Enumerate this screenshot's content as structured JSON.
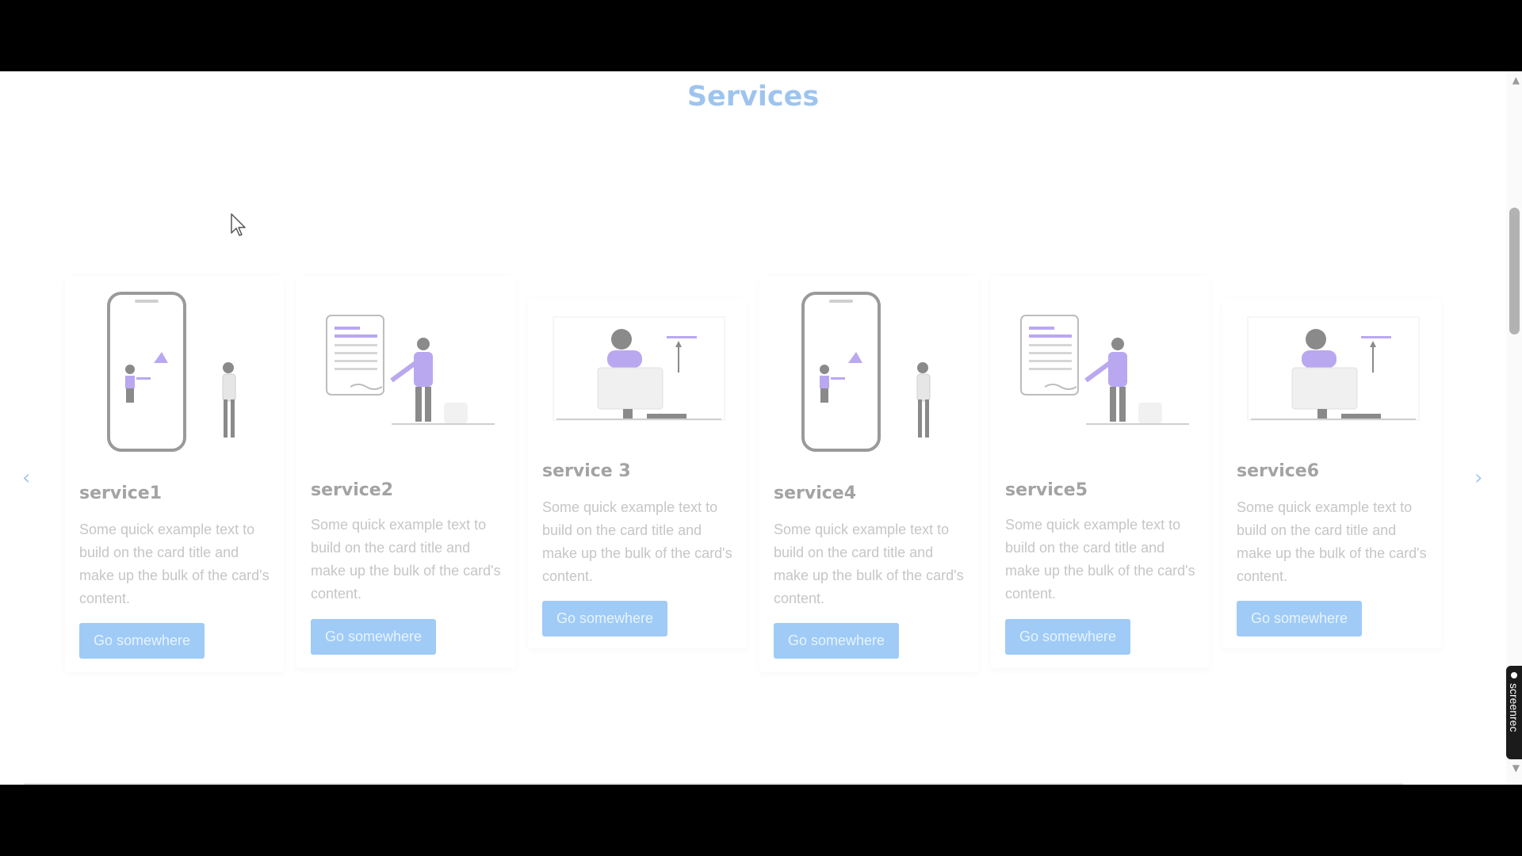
{
  "section": {
    "title": "Services"
  },
  "cards": [
    {
      "title": "service1",
      "text": "Some quick example text to build on the card title and make up the bulk of the card's content.",
      "button": "Go somewhere"
    },
    {
      "title": "service2",
      "text": "Some quick example text to build on the card title and make up the bulk of the card's content.",
      "button": "Go somewhere"
    },
    {
      "title": "service 3",
      "text": "Some quick example text to build on the card title and make up the bulk of the card's content.",
      "button": "Go somewhere"
    },
    {
      "title": "service4",
      "text": "Some quick example text to build on the card title and make up the bulk of the card's content.",
      "button": "Go somewhere"
    },
    {
      "title": "service5",
      "text": "Some quick example text to build on the card title and make up the bulk of the card's content.",
      "button": "Go somewhere"
    },
    {
      "title": "service6",
      "text": "Some quick example text to build on the card title and make up the bulk of the card's content.",
      "button": "Go somewhere"
    }
  ],
  "carousel": {
    "prev_icon": "chevron-left-icon",
    "next_icon": "chevron-right-icon"
  },
  "overlay": {
    "recorder_label": "screenrec"
  },
  "colors": {
    "accent": "#9fcbf6",
    "title": "#9ec4ee",
    "illustration": "#b9a8f0"
  }
}
